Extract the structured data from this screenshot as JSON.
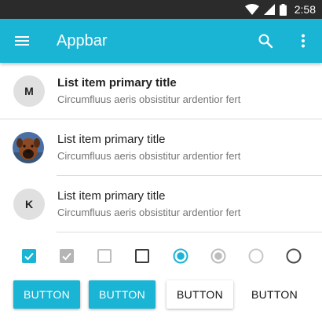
{
  "status_bar": {
    "time": "2:58",
    "icons": [
      "wifi-icon",
      "signal-icon",
      "battery-icon"
    ]
  },
  "appbar": {
    "title": "Appbar",
    "color": "#1ab4d4",
    "icons": [
      "menu-icon",
      "search-icon",
      "more-vert-icon"
    ]
  },
  "list": {
    "items": [
      {
        "avatar_letter": "M",
        "primary": "List item primary title",
        "secondary": "Circumfluus aeris obsistitur ardentior fert"
      },
      {
        "avatar_letter": "",
        "avatar_icon": "dog-photo-avatar",
        "primary": "List item primary title",
        "secondary": "Circumfluus aeris obsistitur ardentior fert"
      },
      {
        "avatar_letter": "K",
        "primary": "List item primary title",
        "secondary": "Circumfluus aeris obsistitur ardentior fert"
      }
    ]
  },
  "controls": {
    "checkbox_checked": true,
    "checkbox_checked_disabled": true,
    "checkbox_unchecked_disabled": false,
    "checkbox_unchecked": false,
    "radio_selected": true,
    "radio_selected_disabled": true,
    "radio_unselected_disabled": false,
    "radio_unselected": false
  },
  "buttons": {
    "raised_accent_label": "BUTTON",
    "raised_accent_2_label": "BUTTON",
    "raised_plain_label": "BUTTON",
    "flat_label": "BUTTON"
  }
}
